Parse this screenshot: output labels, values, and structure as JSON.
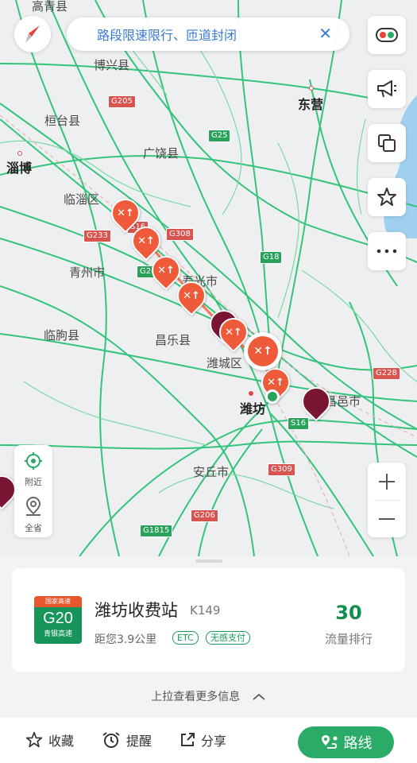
{
  "search": {
    "text": "路段限速限行、匝道封闭"
  },
  "map": {
    "cities": [
      {
        "id": "gaoqing",
        "name": "高青县",
        "major": false
      },
      {
        "id": "boxing",
        "name": "博兴县",
        "major": false
      },
      {
        "id": "dongying",
        "name": "东营",
        "major": true
      },
      {
        "id": "huantai",
        "name": "桓台县",
        "major": false
      },
      {
        "id": "guangrao",
        "name": "广饶县",
        "major": false
      },
      {
        "id": "zibo",
        "name": "淄博",
        "major": true
      },
      {
        "id": "linzi",
        "name": "临淄区",
        "major": false
      },
      {
        "id": "qingzhou",
        "name": "青州市",
        "major": false
      },
      {
        "id": "shouguang",
        "name": "寿光市",
        "major": false
      },
      {
        "id": "linqu",
        "name": "临朐县",
        "major": false
      },
      {
        "id": "changle",
        "name": "昌乐县",
        "major": false
      },
      {
        "id": "weicheng",
        "name": "潍城区",
        "major": false
      },
      {
        "id": "weifang",
        "name": "潍坊",
        "major": true
      },
      {
        "id": "changyi",
        "name": "昌邑市",
        "major": false
      },
      {
        "id": "anqiu",
        "name": "安丘市",
        "major": false
      }
    ],
    "road_shields": [
      {
        "id": "g205",
        "code": "G205",
        "color": "red"
      },
      {
        "id": "g25",
        "code": "G25",
        "color": "green"
      },
      {
        "id": "g233",
        "code": "G233",
        "color": "red"
      },
      {
        "id": "s16a",
        "code": "S16",
        "color": "red"
      },
      {
        "id": "g308",
        "code": "G308",
        "color": "red"
      },
      {
        "id": "g20",
        "code": "G20",
        "color": "green"
      },
      {
        "id": "g18",
        "code": "G18",
        "color": "green"
      },
      {
        "id": "g228",
        "code": "G228",
        "color": "red"
      },
      {
        "id": "s16b",
        "code": "S16",
        "color": "green"
      },
      {
        "id": "g309",
        "code": "G309",
        "color": "red"
      },
      {
        "id": "g206",
        "code": "G206",
        "color": "red"
      },
      {
        "id": "g1815",
        "code": "G1815",
        "color": "green"
      }
    ],
    "incident_symbol": "✕↑"
  },
  "side_buttons": [
    {
      "id": "traffic",
      "icon": "traffic-toggle-icon"
    },
    {
      "id": "report",
      "icon": "megaphone-icon"
    },
    {
      "id": "layers",
      "icon": "layers-icon"
    },
    {
      "id": "favorite",
      "icon": "star-icon"
    },
    {
      "id": "more",
      "icon": "more-icon"
    }
  ],
  "locate": {
    "nearby": "附近",
    "province": "全省"
  },
  "card": {
    "badge_top": "国家高速",
    "badge_code": "G20",
    "badge_name": "青银高速",
    "station_name": "潍坊收费站",
    "km_marker": "K149",
    "distance": "距您3.9公里",
    "tag_etc": "ETC",
    "tag_pay": "无感支付",
    "traffic_value": "30",
    "traffic_label": "流量排行"
  },
  "pull_up": "上拉查看更多信息",
  "bottom": {
    "favorite": "收藏",
    "remind": "提醒",
    "share": "分享",
    "route": "路线"
  },
  "colors": {
    "road": "#33c47a",
    "accent": "#2aab67",
    "incident": "#ef5a3a",
    "search_text": "#3a7bd5"
  }
}
